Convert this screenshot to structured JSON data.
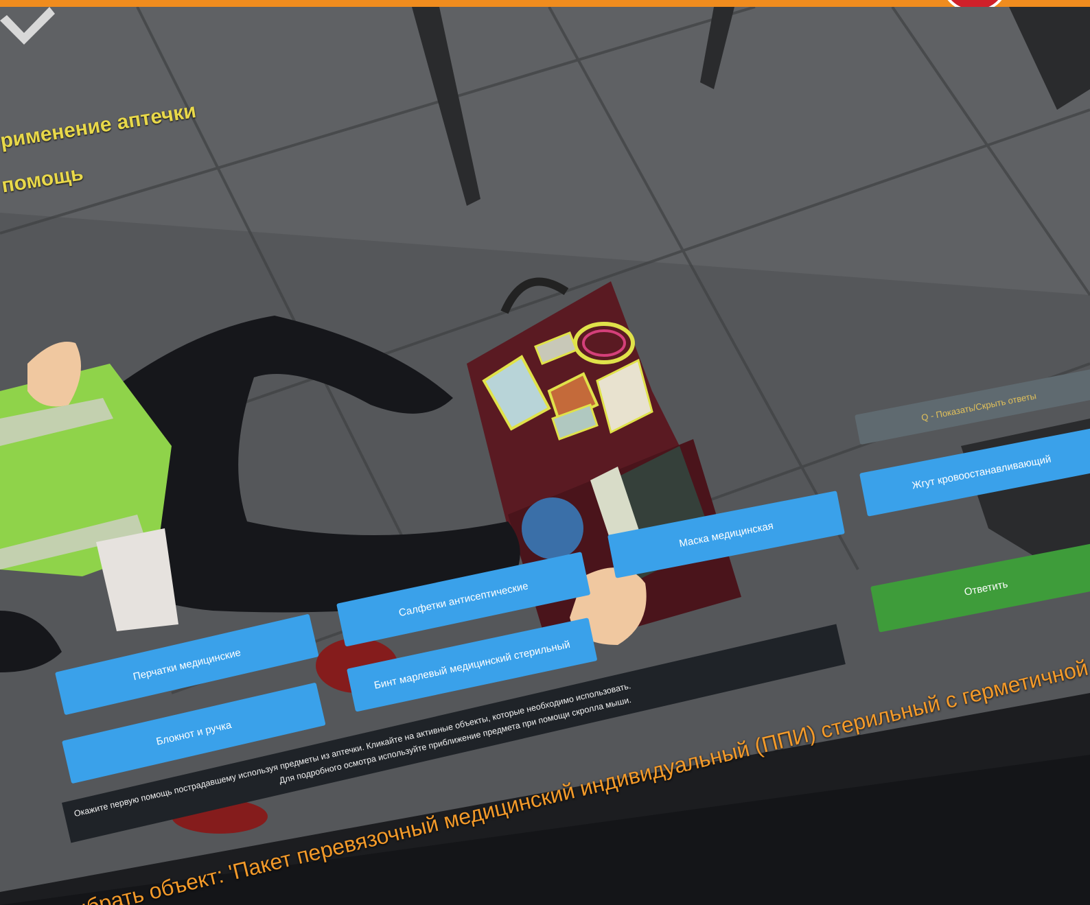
{
  "task": {
    "line1": "рименение аптечки",
    "line2": "помощь"
  },
  "buttons": [
    {
      "label": "Перчатки медицинские"
    },
    {
      "label": "Блокнот и ручка"
    },
    {
      "label": "Салфетки антисептические"
    },
    {
      "label": "Бинт марлевый медицинский стерильный"
    },
    {
      "label": "Маска медицинская"
    },
    {
      "label": "Жгут кровоостанавливающий"
    }
  ],
  "hint_button": {
    "label": "Q - Показать/Скрыть ответы"
  },
  "confirm_button": {
    "label": "Ответить"
  },
  "instructions": {
    "line1": "Окажите первую помощь пострадавшему используя предметы из аптечки. Кликайте на активные объекты, которые необходимо использовать.",
    "line2": "Для подробного осмотра используйте приближение предмета при помощи скролла мыши."
  },
  "objective": {
    "text": "ыбрать объект: 'Пакет перевязочный медицинский индивидуальный (ППИ) стерильный с герметичной оболоч"
  },
  "colors": {
    "task_text": "#e8d84a",
    "item_button": "#3aa1ea",
    "confirm_button": "#3e9c3a",
    "objective_text": "#f39a2a",
    "frame": "#f08c1e"
  },
  "icons": {
    "confirm": "checkmark-icon",
    "logo": "logo-badge"
  }
}
